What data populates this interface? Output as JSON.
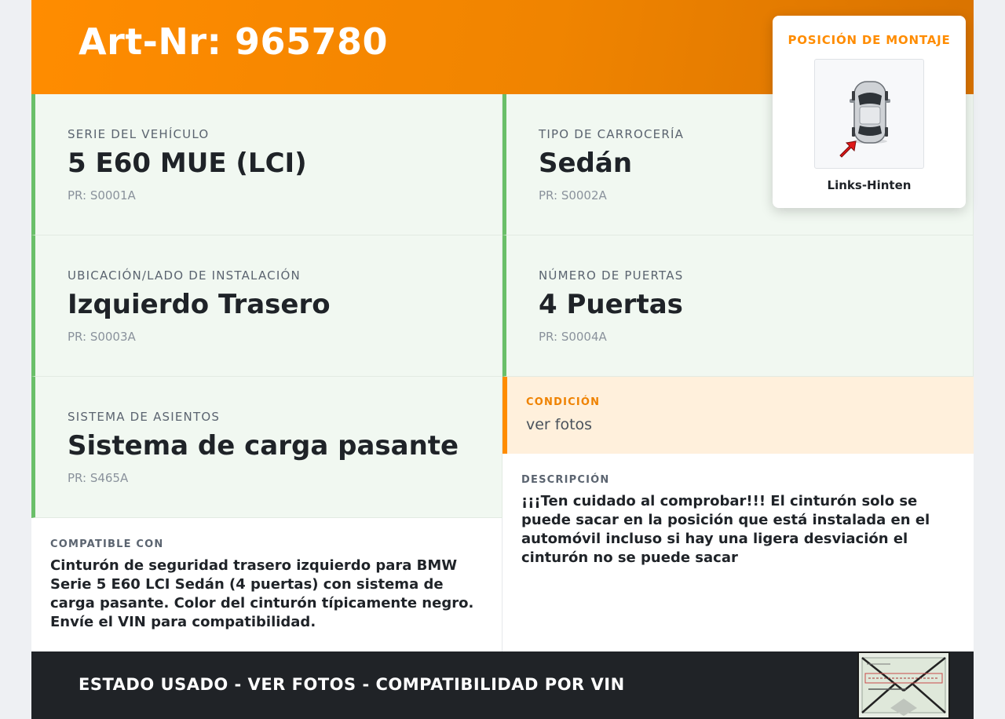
{
  "header": {
    "title": "Art-Nr: 965780"
  },
  "mounting": {
    "title": "POSICIÓN DE MONTAJE",
    "position": "Links-Hinten"
  },
  "specs": [
    {
      "label": "SERIE DEL VEHÍCULO",
      "value": "5 E60 MUE (LCI)",
      "pr": "PR: S0001A"
    },
    {
      "label": "TIPO DE CARROCERÍA",
      "value": "Sedán",
      "pr": "PR: S0002A"
    },
    {
      "label": "UBICACIÓN/LADO DE INSTALACIÓN",
      "value": "Izquierdo Trasero",
      "pr": "PR: S0003A"
    },
    {
      "label": "NÚMERO DE PUERTAS",
      "value": "4 Puertas",
      "pr": "PR: S0004A"
    },
    {
      "label": "SISTEMA DE ASIENTOS",
      "value": "Sistema de carga pasante",
      "pr": "PR: S465A"
    }
  ],
  "condition": {
    "label": "CONDICIÓN",
    "value": "ver fotos"
  },
  "compatible": {
    "label": "COMPATIBLE CON",
    "text": "Cinturón de seguridad trasero izquierdo para BMW Serie 5 E60 LCI Sedán (4 puertas) con sistema de carga pasante. Color del cinturón típicamente negro. Envíe el VIN para compatibilidad."
  },
  "description": {
    "label": "DESCRIPCIÓN",
    "text": "¡¡¡Ten cuidado al comprobar!!! El cinturón solo se puede sacar en la posición que está instalada en el automóvil incluso si hay una ligera desviación el cinturón no se puede sacar"
  },
  "footer": {
    "text": "ESTADO USADO - VER FOTOS - COMPATIBILIDAD POR VIN"
  },
  "colors": {
    "accent": "#ff8c00",
    "green_border": "#6abf69",
    "footer_bg": "#202327"
  }
}
